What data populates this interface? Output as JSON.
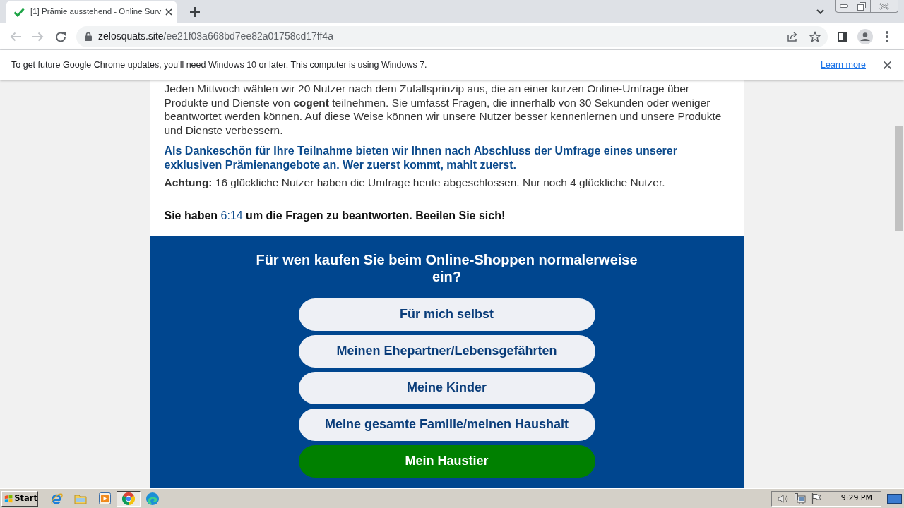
{
  "browser": {
    "tabs": [
      {
        "title": "[1] Prämie ausstehend - Online Surv",
        "selected": true
      }
    ],
    "url": {
      "host": "zelosquats.site",
      "path": "/ee21f03a668bd7ee82a01758cd17ff4a"
    }
  },
  "infobar": {
    "message": "To get future Google Chrome updates, you'll need Windows 10 or later. This computer is using Windows 7.",
    "link": "Learn more"
  },
  "page": {
    "intro": "Jeden Mittwoch wählen wir 20 Nutzer nach dem Zufallsprinzip aus, die an einer kurzen Online-Umfrage über Produkte und Dienste von **cogent** teilnehmen. Sie umfasst Fragen, die innerhalb von 30 Sekunden oder weniger beantwortet werden können. Auf diese Weise können wir unsere Nutzer besser kennenlernen und unsere Produkte und Dienste verbessern.",
    "thanks": "Als Dankeschön für Ihre Teilnahme bieten wir Ihnen nach Abschluss der Umfrage eines unserer exklusiven Prämienangebote an. Wer zuerst kommt, mahlt zuerst.",
    "notice": "**Achtung:** 16 glückliche Nutzer haben die Umfrage heute abgeschlossen. Nur noch 4 glückliche Nutzer.",
    "timer": {
      "before": "Sie haben",
      "time": "6:14",
      "after": "um die Fragen zu beantworten. Beeilen Sie sich!"
    },
    "question": "Für wen kaufen Sie beim Online-Shoppen normalerweise ein?",
    "options": [
      {
        "label": "Für mich selbst",
        "selected": false
      },
      {
        "label": "Meinen Ehepartner/Lebensgefährten",
        "selected": false
      },
      {
        "label": "Meine Kinder",
        "selected": false
      },
      {
        "label": "Meine gesamte Familie/meinen Haushalt",
        "selected": false
      },
      {
        "label": "Mein Haustier",
        "selected": true
      }
    ]
  },
  "taskbar": {
    "start": "Start",
    "apps": [
      {
        "kind": "ie",
        "selected": false
      },
      {
        "kind": "explorer",
        "selected": false
      },
      {
        "kind": "player",
        "selected": false
      },
      {
        "kind": "chrome",
        "selected": true
      },
      {
        "kind": "edge",
        "selected": false
      }
    ],
    "clock": "9:29 PM"
  }
}
